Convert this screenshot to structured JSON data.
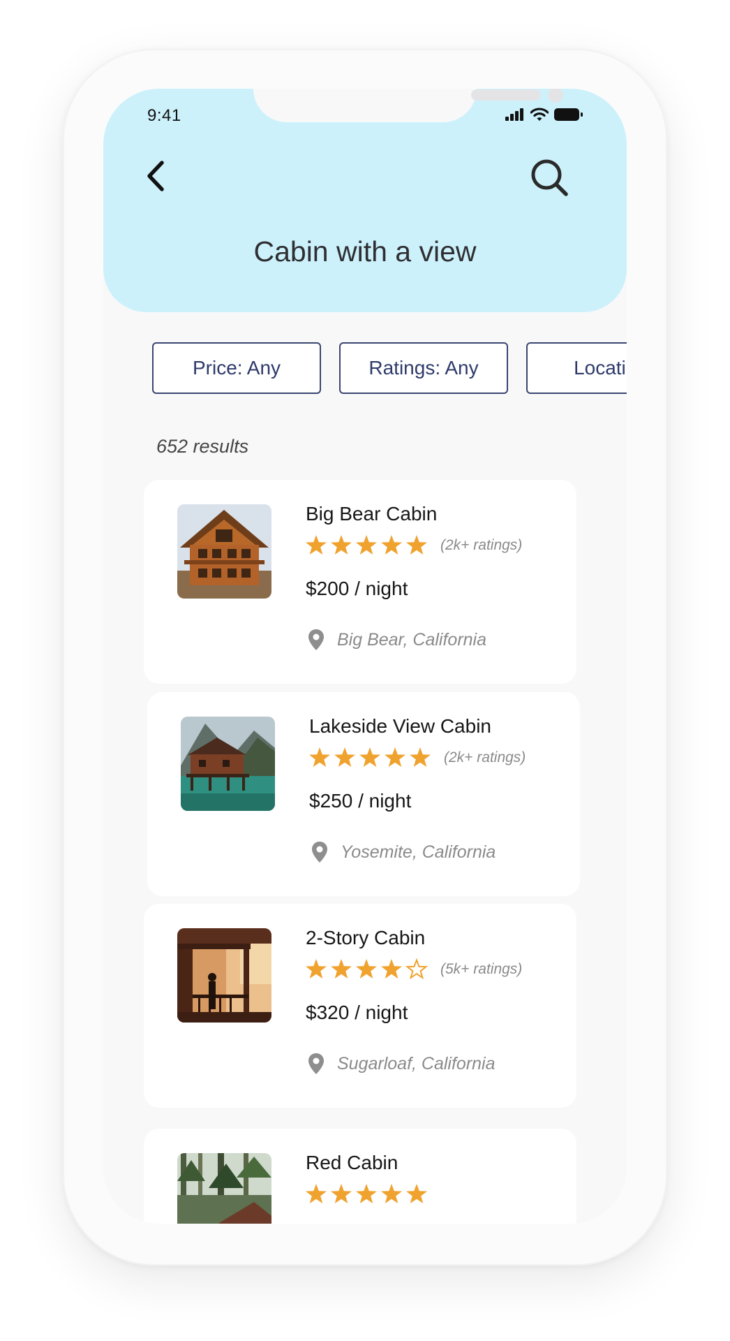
{
  "status_bar": {
    "time": "9:41"
  },
  "header": {
    "title": "Cabin with a view"
  },
  "filters": [
    {
      "label": "Price: Any"
    },
    {
      "label": "Ratings: Any"
    },
    {
      "label": "Location"
    }
  ],
  "results": {
    "count_text": "652 results",
    "items": [
      {
        "name": "Big Bear Cabin",
        "rating": 5,
        "rating_text": "(2k+ ratings)",
        "price": "$200",
        "price_unit": " / night",
        "location": "Big Bear, California",
        "icon": "cabin-photo"
      },
      {
        "name": "Lakeside View Cabin",
        "rating": 5,
        "rating_text": "(2k+ ratings)",
        "price": "$250",
        "price_unit": " / night",
        "location": "Yosemite, California",
        "icon": "cabin-photo"
      },
      {
        "name": "2-Story Cabin",
        "rating": 4,
        "rating_text": "(5k+ ratings)",
        "price": "$320",
        "price_unit": " / night",
        "location": "Sugarloaf, California",
        "icon": "cabin-photo"
      },
      {
        "name": "Red Cabin",
        "rating": 5,
        "rating_text": "",
        "price": "",
        "price_unit": "",
        "location": "",
        "icon": "cabin-photo"
      }
    ]
  },
  "colors": {
    "header_bg": "#ccf1fb",
    "star": "#f0a22e",
    "chip_border": "#3a4670"
  }
}
